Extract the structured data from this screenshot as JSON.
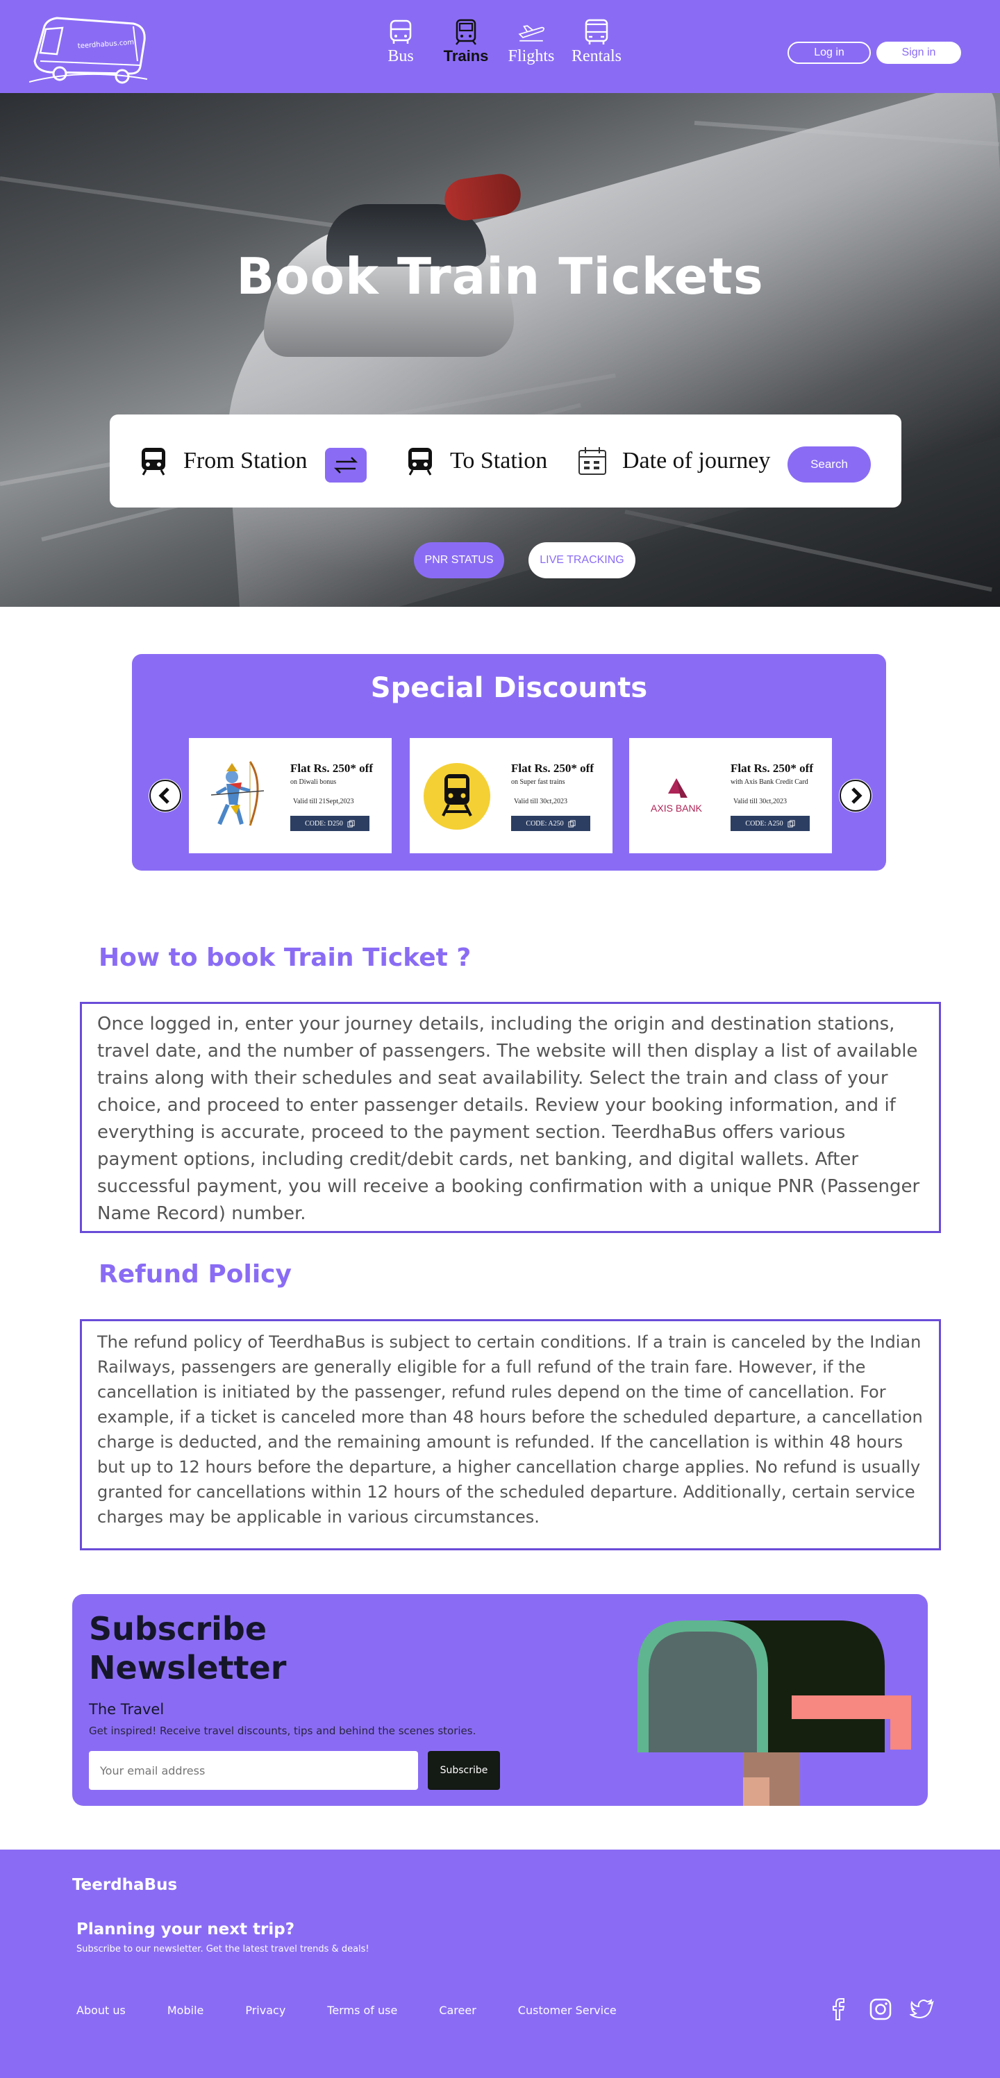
{
  "header": {
    "logo_text": "teerdhabus.com",
    "nav": [
      {
        "label": "Bus",
        "icon": "bus-icon"
      },
      {
        "label": "Trains",
        "icon": "train-icon"
      },
      {
        "label": "Flights",
        "icon": "plane-icon"
      },
      {
        "label": "Rentals",
        "icon": "rental-bus-icon"
      }
    ],
    "active_nav": "Trains",
    "login_label": "Log in",
    "signin_label": "Sign in"
  },
  "hero": {
    "title": "Book Train Tickets",
    "search": {
      "from_label": "From Station",
      "to_label": "To Station",
      "date_label": "Date of journey",
      "search_label": "Search"
    },
    "pnr_label": "PNR STATUS",
    "live_label": "LIVE TRACKING"
  },
  "discounts": {
    "title": "Special Discounts",
    "cards": [
      {
        "headline": "Flat Rs. 250* off",
        "sub": "on Diwali bonus",
        "valid": "Valid till 21Sept,2023",
        "code": "CODE: D250",
        "image": "archer-illustration"
      },
      {
        "headline": "Flat Rs. 250* off",
        "sub": "on Super fast trains",
        "valid": "Valid till 30ct,2023",
        "code": "CODE: A250",
        "image": "train-icon"
      },
      {
        "headline": "Flat Rs. 250* off",
        "sub": "with Axis Bank Credit Card",
        "valid": "Valid till 30ct,2023",
        "code": "CODE: A250",
        "image": "axis-bank-logo",
        "logo_text": "AXIS BANK"
      }
    ]
  },
  "how_to": {
    "title": "How  to book Train Ticket ?",
    "body": "Once logged in, enter your journey details, including the origin and destination stations, travel date, and the number of passengers. The website will then display a list of available trains along with their schedules and seat availability. Select the train and class of your choice, and proceed to enter passenger details. Review your booking information, and if everything is accurate, proceed to the payment section. TeerdhaBus offers various payment options, including credit/debit cards, net banking, and digital wallets. After successful payment, you will receive a booking confirmation with a unique PNR (Passenger Name Record) number."
  },
  "refund": {
    "title": "Refund Policy",
    "body": "The refund policy of TeerdhaBus is subject to certain conditions. If a train is canceled by the Indian Railways, passengers are generally eligible for a full refund of the train fare. However, if the cancellation is initiated by the passenger, refund rules depend on the time of cancellation. For example, if a ticket is canceled more than 48 hours before the scheduled departure, a cancellation charge is deducted, and the remaining amount is refunded. If the cancellation is within 48 hours but up to 12 hours before the departure, a higher cancellation charge applies. No refund is usually granted for cancellations within 12 hours of the scheduled departure. Additionally, certain service charges may be applicable in various circumstances."
  },
  "newsletter": {
    "title_line1": "Subscribe",
    "title_line2": "Newsletter",
    "subtitle": "The Travel",
    "description": "Get inspired! Receive travel discounts, tips and behind the scenes stories.",
    "email_placeholder": "Your email address",
    "button_label": "Subscribe"
  },
  "footer": {
    "brand": "TeerdhaBus",
    "plan_title": "Planning your next trip?",
    "plan_sub": "Subscribe to our newsletter. Get the latest travel trends & deals!",
    "links": [
      "About us",
      "Mobile",
      "Privacy",
      "Terms of use",
      "Career",
      "Customer Service"
    ],
    "social": [
      "facebook-icon",
      "instagram-icon",
      "twitter-icon"
    ]
  },
  "colors": {
    "brand": "#8a6cf4",
    "text_dark": "#16162a",
    "border": "#6a4cd8"
  }
}
